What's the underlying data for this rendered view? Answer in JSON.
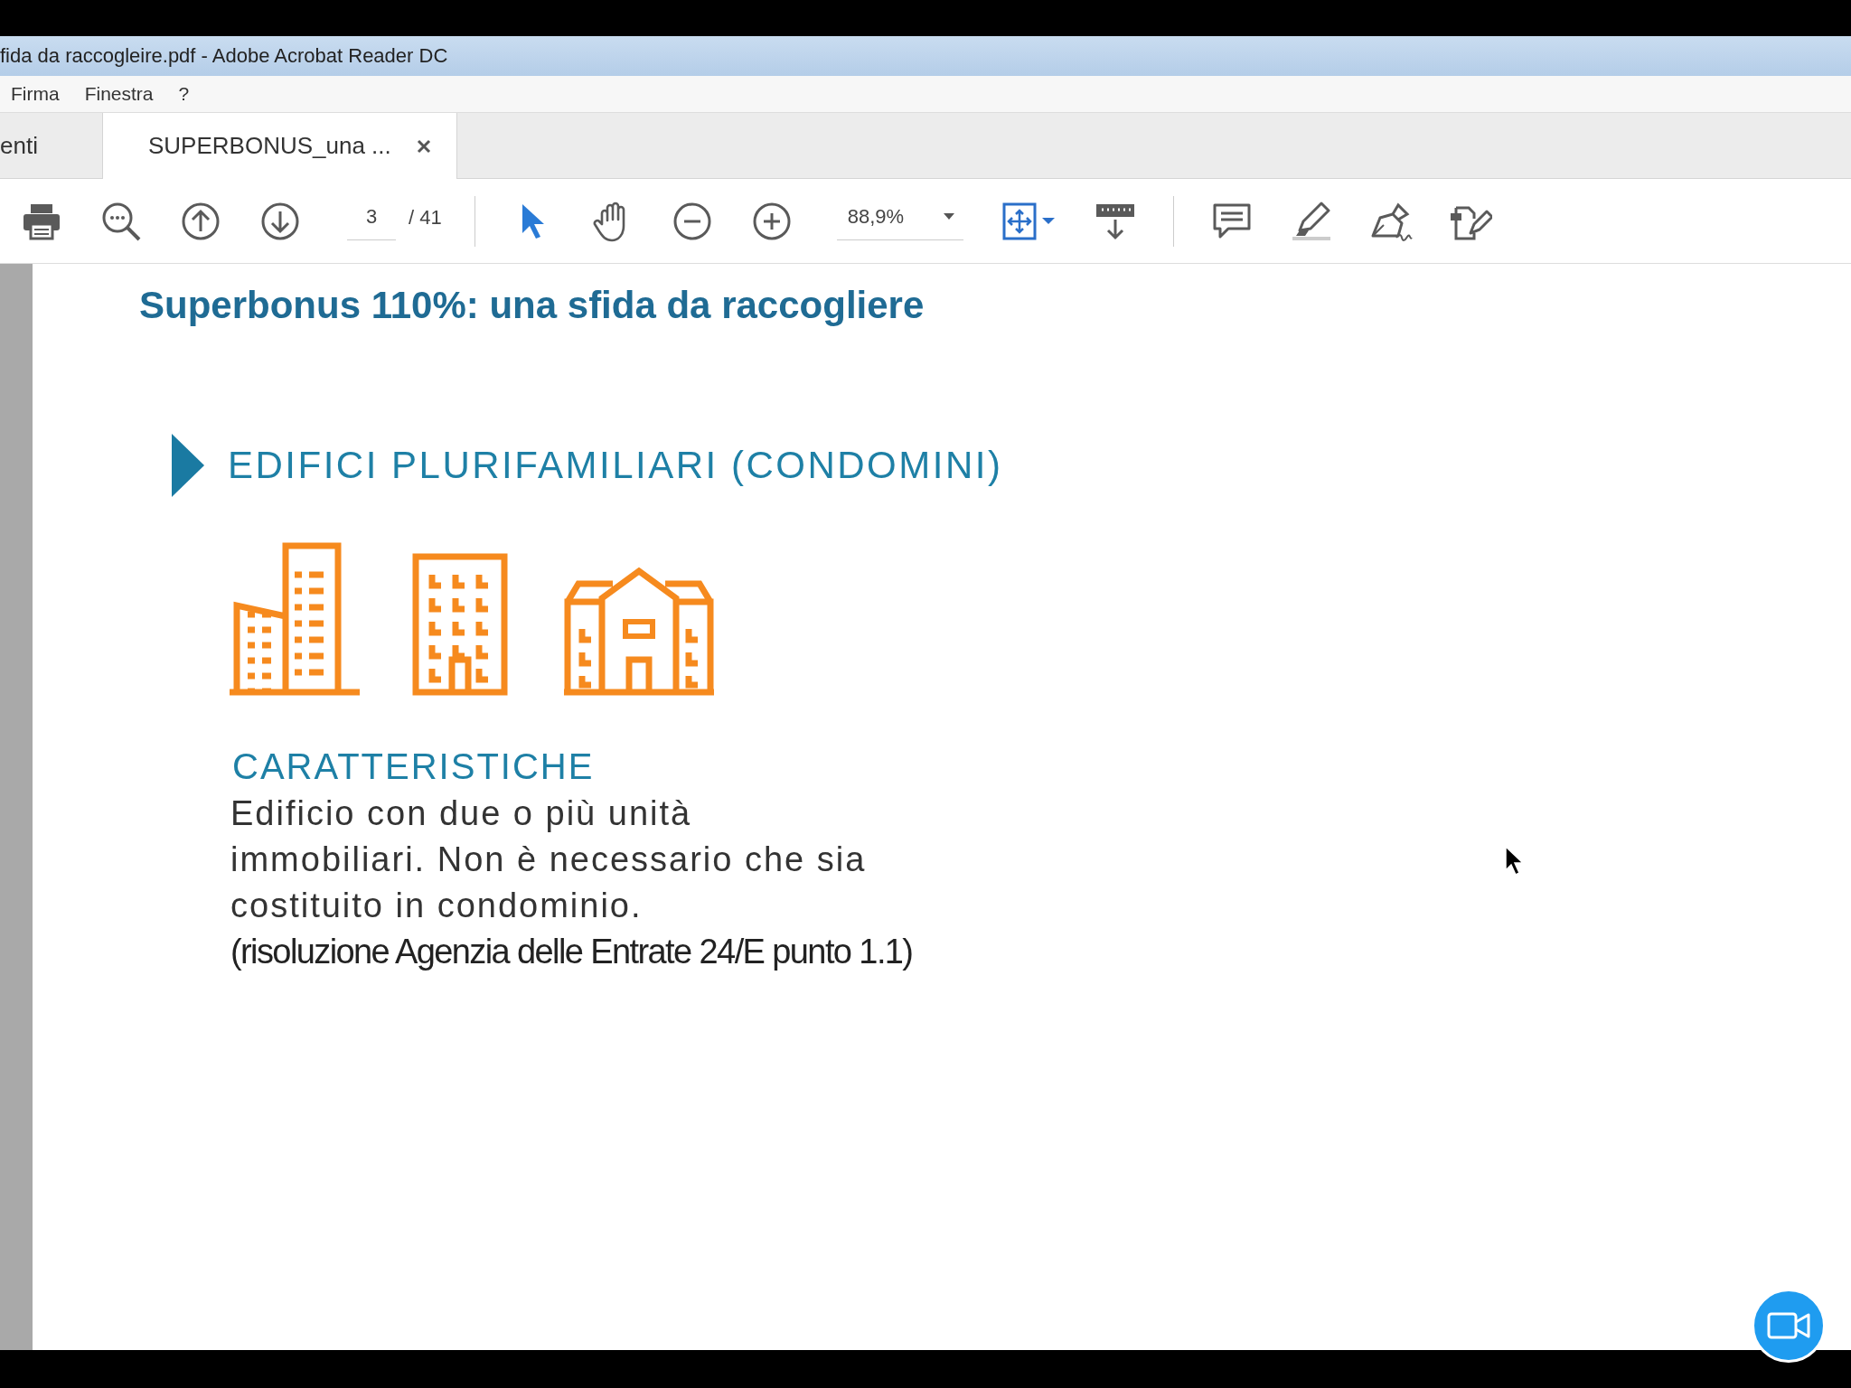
{
  "window": {
    "title": "fida da raccogleire.pdf - Adobe Acrobat Reader DC"
  },
  "menu": [
    "Firma",
    "Finestra",
    "?"
  ],
  "tabs": [
    {
      "label": "enti",
      "selected": false,
      "closable": false
    },
    {
      "label": "SUPERBONUS_una ...",
      "selected": true,
      "closable": true
    }
  ],
  "toolbar": {
    "page_number": "3",
    "page_total": "/ 41",
    "zoom": "88,9%",
    "tools": [
      {
        "kind": "select",
        "selected": true
      },
      {
        "kind": "hand",
        "selected": false
      }
    ]
  },
  "document": {
    "title": "Superbonus 110%: una sfida da raccogliere",
    "section_heading": "EDIFICI PLURIFAMILIARI (CONDOMINI)",
    "subheading": "CARATTERISTICHE",
    "body": "Edificio con due o più unità immobiliari. Non è necessario che sia costituito in condominio.",
    "citation": "(risoluzione Agenzia delle Entrate 24/E punto 1.1)"
  }
}
